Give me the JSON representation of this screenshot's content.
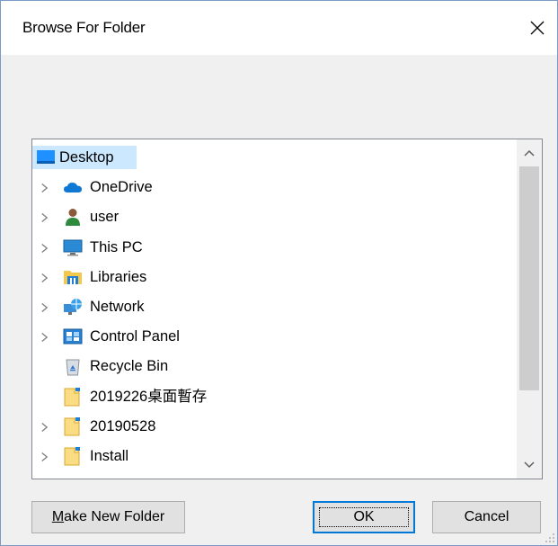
{
  "window": {
    "title": "Browse For Folder",
    "close_icon": "close-icon"
  },
  "tree": {
    "items": [
      {
        "label": "Desktop",
        "icon": "desktop-icon",
        "expandable": false,
        "selected": true
      },
      {
        "label": "OneDrive",
        "icon": "cloud-icon",
        "expandable": true
      },
      {
        "label": "user",
        "icon": "user-icon",
        "expandable": true
      },
      {
        "label": "This PC",
        "icon": "computer-icon",
        "expandable": true
      },
      {
        "label": "Libraries",
        "icon": "library-folder-icon",
        "expandable": true
      },
      {
        "label": "Network",
        "icon": "network-icon",
        "expandable": true
      },
      {
        "label": "Control Panel",
        "icon": "control-panel-icon",
        "expandable": true
      },
      {
        "label": "Recycle Bin",
        "icon": "recycle-bin-icon",
        "expandable": false
      },
      {
        "label": "2019226桌面暫存",
        "icon": "folder-icon",
        "expandable": false
      },
      {
        "label": "20190528",
        "icon": "folder-icon",
        "expandable": true
      },
      {
        "label": "Install",
        "icon": "folder-icon",
        "expandable": true
      }
    ]
  },
  "buttons": {
    "make_new_folder": "Make New Folder",
    "make_new_folder_accel": "M",
    "make_new_folder_rest": "ake New Folder",
    "ok": "OK",
    "cancel": "Cancel"
  },
  "colors": {
    "selection": "#cce8ff",
    "accent": "#0078d7"
  }
}
